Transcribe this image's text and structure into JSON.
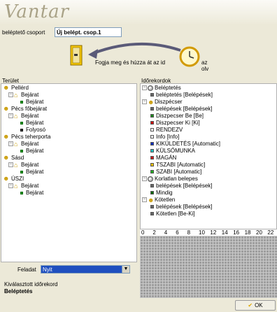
{
  "header": {
    "logo": "Vantar"
  },
  "group": {
    "label": "beléptető csoport",
    "value": "Új belépt. csop.1"
  },
  "banner": {
    "text": "Fogja meg és húzza át az id",
    "text_tail": "az olv"
  },
  "left_panel": {
    "title": "Terület",
    "tree": [
      {
        "level": 0,
        "toggle": "",
        "icon": "people",
        "label": "Pellérd"
      },
      {
        "level": 1,
        "toggle": "−",
        "icon": "home",
        "label": "Bejárat"
      },
      {
        "level": 2,
        "toggle": "",
        "icon": "dot",
        "label": "Bejárat"
      },
      {
        "level": 0,
        "toggle": "",
        "icon": "people",
        "label": "Pécs főbejárat"
      },
      {
        "level": 1,
        "toggle": "−",
        "icon": "home",
        "label": "Bejárat"
      },
      {
        "level": 2,
        "toggle": "",
        "icon": "dot",
        "label": "Bejárat"
      },
      {
        "level": 2,
        "toggle": "",
        "icon": "dot-dark",
        "label": "Folyosó"
      },
      {
        "level": 0,
        "toggle": "",
        "icon": "people",
        "label": "Pécs teherporta"
      },
      {
        "level": 1,
        "toggle": "−",
        "icon": "home",
        "label": "Bejárat"
      },
      {
        "level": 2,
        "toggle": "",
        "icon": "dot",
        "label": "Bejárat"
      },
      {
        "level": 0,
        "toggle": "",
        "icon": "people",
        "label": "Sásd"
      },
      {
        "level": 1,
        "toggle": "−",
        "icon": "home",
        "label": "Bejárat"
      },
      {
        "level": 2,
        "toggle": "",
        "icon": "dot",
        "label": "Bejárat"
      },
      {
        "level": 0,
        "toggle": "",
        "icon": "people",
        "label": "ÚSZI"
      },
      {
        "level": 1,
        "toggle": "−",
        "icon": "home",
        "label": "Bejárat"
      },
      {
        "level": 2,
        "toggle": "",
        "icon": "dot",
        "label": "Bejárat"
      }
    ]
  },
  "right_panel": {
    "title": "Időrekordok",
    "tree": [
      {
        "level": 0,
        "toggle": "−",
        "icon": "globe",
        "label": "Beléptetés"
      },
      {
        "level": 1,
        "toggle": "",
        "color": "#666666",
        "label": "beléptetés [Belépések]"
      },
      {
        "level": 0,
        "toggle": "−",
        "icon": "group",
        "label": "Diszpécser"
      },
      {
        "level": 1,
        "toggle": "",
        "color": "#666666",
        "label": "belépések [Belépések]"
      },
      {
        "level": 1,
        "toggle": "",
        "color": "#1a8a1a",
        "label": "Diszpecser Be [Be]"
      },
      {
        "level": 1,
        "toggle": "",
        "color": "#d01010",
        "label": "Diszpecser Ki [Ki]"
      },
      {
        "level": 1,
        "toggle": "",
        "color": "#ffffff",
        "label": "RENDEZV"
      },
      {
        "level": 1,
        "toggle": "",
        "color": "#ffffff",
        "label": "Info [Info]"
      },
      {
        "level": 1,
        "toggle": "",
        "color": "#1030c0",
        "label": "KIKÜLDETÉS [Automatic]"
      },
      {
        "level": 1,
        "toggle": "",
        "color": "#20c0c0",
        "label": "KÜLSŐMUNKA"
      },
      {
        "level": 1,
        "toggle": "",
        "color": "#c81818",
        "label": "MAGÁN"
      },
      {
        "level": 1,
        "toggle": "",
        "color": "#f0c000",
        "label": "TSZABI [Automatic]"
      },
      {
        "level": 1,
        "toggle": "",
        "color": "#20b020",
        "label": "SZABI [Automatic]"
      },
      {
        "level": 0,
        "toggle": "−",
        "icon": "globe",
        "label": "Korlatlan belepes"
      },
      {
        "level": 1,
        "toggle": "",
        "color": "#666666",
        "label": "belépések [Belépések]"
      },
      {
        "level": 1,
        "toggle": "",
        "color": "#0a6a0a",
        "label": "Mindig"
      },
      {
        "level": 0,
        "toggle": "−",
        "icon": "group",
        "label": "Kötetlen"
      },
      {
        "level": 1,
        "toggle": "",
        "color": "#666666",
        "label": "belépések [Belépések]"
      },
      {
        "level": 1,
        "toggle": "",
        "color": "#666666",
        "label": "Kötetlen [Be-Ki]"
      }
    ]
  },
  "ruler": {
    "ticks": [
      "0",
      "2",
      "4",
      "6",
      "8",
      "10",
      "12",
      "14",
      "16",
      "18",
      "20",
      "22"
    ]
  },
  "task": {
    "label": "Feladat",
    "value": "Nyit"
  },
  "selected_record": {
    "label": "Kiválasztott időrekord",
    "value": "Beléptetés"
  },
  "ok_button": {
    "label": "OK"
  }
}
